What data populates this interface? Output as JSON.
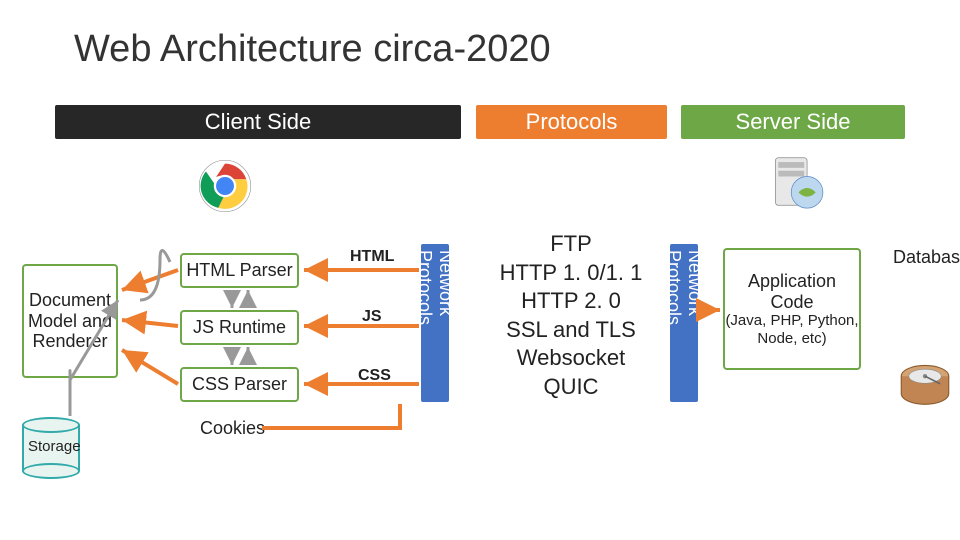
{
  "title": "Web Architecture circa-2020",
  "headers": {
    "client": "Client Side",
    "protocols": "Protocols",
    "server": "Server Side"
  },
  "client": {
    "doc_model": "Document Model and Renderer",
    "parsers": {
      "html": "HTML Parser",
      "js": "JS Runtime",
      "css": "CSS Parser"
    },
    "cookies": "Cookies",
    "storage": "Storage",
    "data_labels": {
      "html": "HTML",
      "js": "JS",
      "css": "CSS"
    }
  },
  "network_protocols_label": "Network Protocols",
  "protocols_list": [
    "FTP",
    "HTTP 1. 0/1. 1",
    "HTTP 2. 0",
    "SSL and TLS",
    "Websocket",
    "QUIC"
  ],
  "server": {
    "app_code_title": "Application Code",
    "app_code_sub": "(Java, PHP, Python, Node, etc)",
    "database": "Database"
  },
  "colors": {
    "orange": "#ed7d2f",
    "green": "#6ea746",
    "blue": "#4372c4",
    "dark": "#272727"
  }
}
